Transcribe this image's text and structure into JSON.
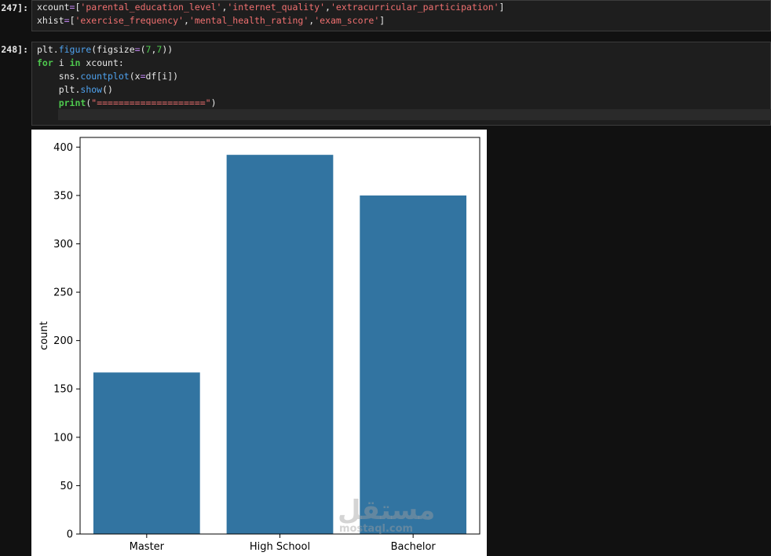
{
  "cells": [
    {
      "prompt": "247]:",
      "lines": [
        [
          {
            "t": "xcount",
            "c": ""
          },
          {
            "t": "=",
            "c": "op"
          },
          {
            "t": "[",
            "c": ""
          },
          {
            "t": "'parental_education_level'",
            "c": "str"
          },
          {
            "t": ",",
            "c": ""
          },
          {
            "t": "'internet_quality'",
            "c": "str"
          },
          {
            "t": ",",
            "c": ""
          },
          {
            "t": "'extracurricular_participation'",
            "c": "str"
          },
          {
            "t": "]",
            "c": ""
          }
        ],
        [
          {
            "t": "xhist",
            "c": ""
          },
          {
            "t": "=",
            "c": "op"
          },
          {
            "t": "[",
            "c": ""
          },
          {
            "t": "'exercise_frequency'",
            "c": "str"
          },
          {
            "t": ",",
            "c": ""
          },
          {
            "t": "'mental_health_rating'",
            "c": "str"
          },
          {
            "t": ",",
            "c": ""
          },
          {
            "t": "'exam_score'",
            "c": "str"
          },
          {
            "t": "]",
            "c": ""
          }
        ]
      ]
    },
    {
      "prompt": "248]:",
      "lines": [
        [
          {
            "t": "plt.",
            "c": ""
          },
          {
            "t": "figure",
            "c": "fn"
          },
          {
            "t": "(figsize",
            "c": ""
          },
          {
            "t": "=",
            "c": "op"
          },
          {
            "t": "(",
            "c": ""
          },
          {
            "t": "7",
            "c": "num"
          },
          {
            "t": ",",
            "c": ""
          },
          {
            "t": "7",
            "c": "num"
          },
          {
            "t": "))",
            "c": ""
          }
        ],
        [
          {
            "t": "for",
            "c": "kw"
          },
          {
            "t": " i ",
            "c": ""
          },
          {
            "t": "in",
            "c": "kw"
          },
          {
            "t": " xcount:",
            "c": ""
          }
        ],
        [
          {
            "t": "    sns.",
            "c": ""
          },
          {
            "t": "countplot",
            "c": "fn"
          },
          {
            "t": "(x",
            "c": ""
          },
          {
            "t": "=",
            "c": "op"
          },
          {
            "t": "df[i])",
            "c": ""
          }
        ],
        [
          {
            "t": "    plt.",
            "c": ""
          },
          {
            "t": "show",
            "c": "fn"
          },
          {
            "t": "()",
            "c": ""
          }
        ],
        [
          {
            "t": "    ",
            "c": ""
          },
          {
            "t": "print",
            "c": "kw"
          },
          {
            "t": "(",
            "c": ""
          },
          {
            "t": "\"====================\"",
            "c": "str"
          },
          {
            "t": ")",
            "c": ""
          }
        ]
      ]
    }
  ],
  "chart_data": {
    "type": "bar",
    "categories": [
      "Master",
      "High School",
      "Bachelor"
    ],
    "values": [
      167,
      392,
      350
    ],
    "ylabel": "count",
    "xlabel": "",
    "ylim": [
      0,
      410
    ],
    "yticks": [
      0,
      50,
      100,
      150,
      200,
      250,
      300,
      350,
      400
    ],
    "bar_color": "#3274a1",
    "grid": false
  },
  "watermark": {
    "arabic": "مستقل",
    "latin": "mostaql.com"
  }
}
